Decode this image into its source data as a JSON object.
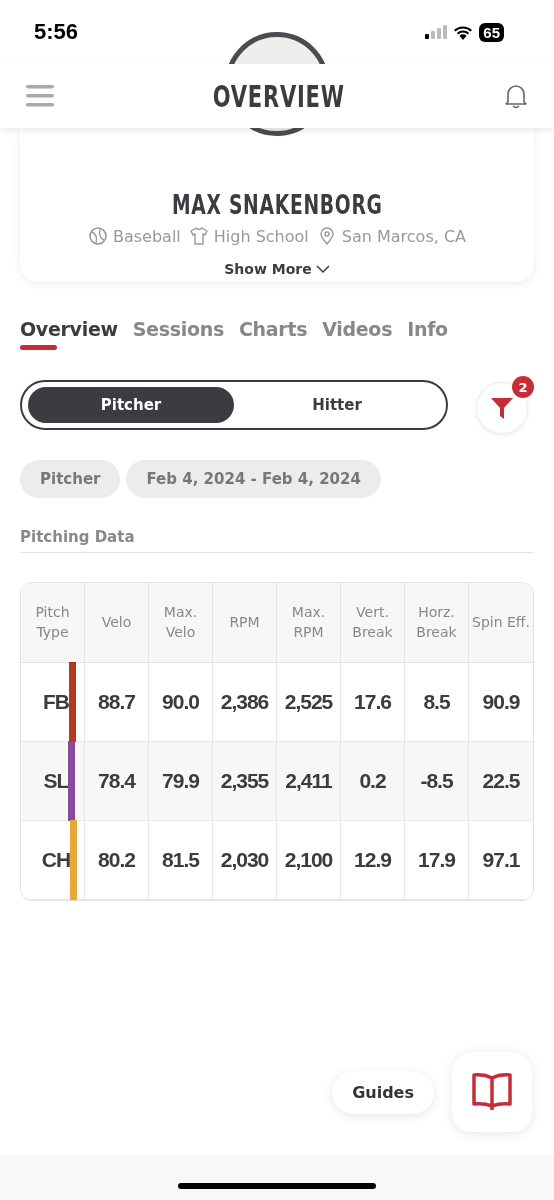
{
  "status_bar": {
    "time": "5:56",
    "battery": "65"
  },
  "header": {
    "title": "OVERVIEW"
  },
  "profile": {
    "name": "MAX SNAKENBORG",
    "details": [
      {
        "kind": "sport",
        "text": "Baseball"
      },
      {
        "kind": "level",
        "text": "High School"
      },
      {
        "kind": "location",
        "text": "San Marcos, CA"
      }
    ],
    "show_more": "Show More"
  },
  "tabs": [
    {
      "label": "Overview",
      "selected": true
    },
    {
      "label": "Sessions",
      "selected": false
    },
    {
      "label": "Charts",
      "selected": false
    },
    {
      "label": "Videos",
      "selected": false
    },
    {
      "label": "Info",
      "selected": false
    }
  ],
  "role_toggle": [
    {
      "label": "Pitcher",
      "selected": true
    },
    {
      "label": "Hitter",
      "selected": false
    }
  ],
  "filter": {
    "badge": "2"
  },
  "chips": [
    "Pitcher",
    "Feb 4, 2024 - Feb 4, 2024"
  ],
  "section_title": "Pitching Data",
  "table": {
    "columns": [
      "Pitch Type",
      "Velo",
      "Max. Velo",
      "RPM",
      "Max. RPM",
      "Vert. Break",
      "Horz. Break",
      "Spin Eff."
    ],
    "rows": [
      {
        "color": "#b5391f",
        "cells": [
          "FB",
          "88.7",
          "90.0",
          "2,386",
          "2,525",
          "17.6",
          "8.5",
          "90.9"
        ]
      },
      {
        "color": "#8b4a9c",
        "cells": [
          "SL",
          "78.4",
          "79.9",
          "2,355",
          "2,411",
          "0.2",
          "-8.5",
          "22.5"
        ]
      },
      {
        "color": "#e8a838",
        "cells": [
          "CH",
          "80.2",
          "81.5",
          "2,030",
          "2,100",
          "12.9",
          "17.9",
          "97.1"
        ]
      }
    ]
  },
  "guides_button": "Guides"
}
